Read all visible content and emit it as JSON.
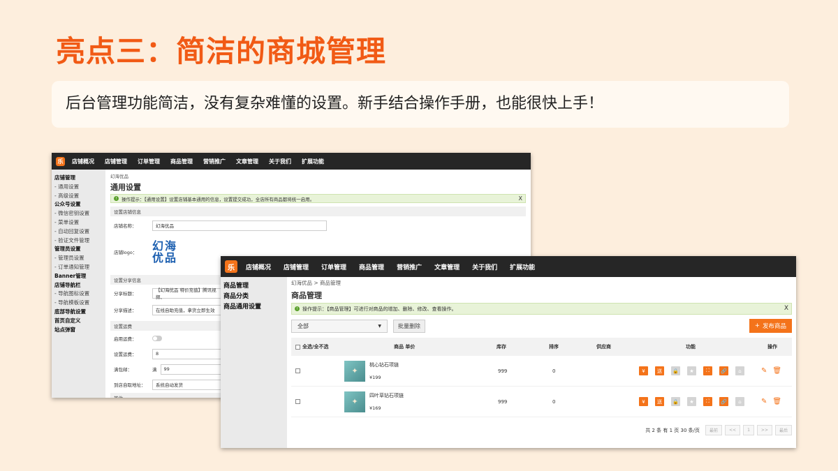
{
  "slide": {
    "title": "亮点三：简洁的商城管理",
    "subtitle": "后台管理功能简洁，没有复杂难懂的设置。新手结合操作手册，也能很快上手！"
  },
  "panel1": {
    "logo_glyph": "乐",
    "nav": [
      "店铺概况",
      "店铺管理",
      "订单管理",
      "商品管理",
      "营销推广",
      "文章管理",
      "关于我们",
      "扩展功能"
    ],
    "sidebar": [
      {
        "label": "店铺管理",
        "type": "head"
      },
      {
        "label": "- 通用设置",
        "type": "sub"
      },
      {
        "label": "- 高级设置",
        "type": "sub"
      },
      {
        "label": "公众号设置",
        "type": "head"
      },
      {
        "label": "- 微信密钥设置",
        "type": "sub"
      },
      {
        "label": "- 菜单设置",
        "type": "sub"
      },
      {
        "label": "- 自动回复设置",
        "type": "sub"
      },
      {
        "label": "- 验证文件管理",
        "type": "sub"
      },
      {
        "label": "管理员设置",
        "type": "head"
      },
      {
        "label": "- 管理员设置",
        "type": "sub"
      },
      {
        "label": "- 订单通知管理",
        "type": "sub"
      },
      {
        "label": "Banner管理",
        "type": "head"
      },
      {
        "label": "店铺导航栏",
        "type": "head"
      },
      {
        "label": "- 导航图标设置",
        "type": "sub"
      },
      {
        "label": "- 导航模板设置",
        "type": "sub"
      },
      {
        "label": "底部导航设置",
        "type": "head"
      },
      {
        "label": "首页自定义",
        "type": "head"
      },
      {
        "label": "站点弹窗",
        "type": "head"
      }
    ],
    "breadcrumb": "幻海优品",
    "page_title": "通用设置",
    "tip": "操作提示：【通用设置】设置店铺基本通用的信息，设置提交成功，全店所有商品都将统一启用。",
    "tip_close": "X",
    "section_basic": "设置店铺信息",
    "shop_name_label": "店铺名称：",
    "shop_name_value": "幻海优品",
    "logo_label": "店铺logo：",
    "logo_text_line1": "幻海",
    "logo_text_line2": "优品",
    "section_share": "设置分享信息",
    "share_title_label": "分享标题：",
    "share_title_value": "【幻海优品 特价充值】腾讯视频、",
    "share_desc_label": "分享描述：",
    "share_desc_value": "在线自助充值，拿货立即生效",
    "section_shipping": "设置运费",
    "enable_shipping_label": "启用运费：",
    "shipping_label": "设置运费：",
    "shipping_value": "8",
    "free_label": "满包邮：",
    "free_prefix": "满",
    "free_value": "99",
    "pickup_label": "到店自取地址：",
    "pickup_value": "系统自动发货",
    "section_other": "其他"
  },
  "panel2": {
    "logo_glyph": "乐",
    "nav": [
      "店铺概况",
      "店铺管理",
      "订单管理",
      "商品管理",
      "营销推广",
      "文章管理",
      "关于我们",
      "扩展功能"
    ],
    "sidebar": [
      "商品管理",
      "商品分类",
      "商品通用设置"
    ],
    "breadcrumb": "幻海优品 > 商品管理",
    "page_title": "商品管理",
    "tip": "操作提示：【商品管理】可进行对商品的增加、删除、修改、查看操作。",
    "tip_close": "X",
    "select_value": "全部",
    "batch_delete": "批量删除",
    "publish": "发布商品",
    "headers": {
      "select_all": "全选/全不选",
      "product": "商品 单价",
      "stock": "库存",
      "sort": "排序",
      "supplier": "供应商",
      "function": "功能",
      "action": "操作"
    },
    "rows": [
      {
        "name": "桃心钻石项链",
        "price": "¥199",
        "stock": "999",
        "sort": "0"
      },
      {
        "name": "四叶草钻石项链",
        "price": "¥169",
        "stock": "999",
        "sort": "0"
      }
    ],
    "function_icons": [
      {
        "glyph": "¥",
        "name": "price-icon",
        "active": true
      },
      {
        "glyph": "送",
        "name": "gift-icon",
        "active": true
      },
      {
        "glyph": "🔒",
        "name": "lock-icon",
        "active": false
      },
      {
        "glyph": "★",
        "name": "star-icon",
        "active": false
      },
      {
        "glyph": "⛶",
        "name": "qrcode-icon",
        "active": true
      },
      {
        "glyph": "🔗",
        "name": "link-icon",
        "active": true
      },
      {
        "glyph": "⌂",
        "name": "shop-icon",
        "active": false
      }
    ],
    "pager": {
      "summary": "共 2 条 有 1 页 30 条/页",
      "first": "最前",
      "prev": "<<",
      "current": "1",
      "next": ">>",
      "last": "最后"
    }
  }
}
